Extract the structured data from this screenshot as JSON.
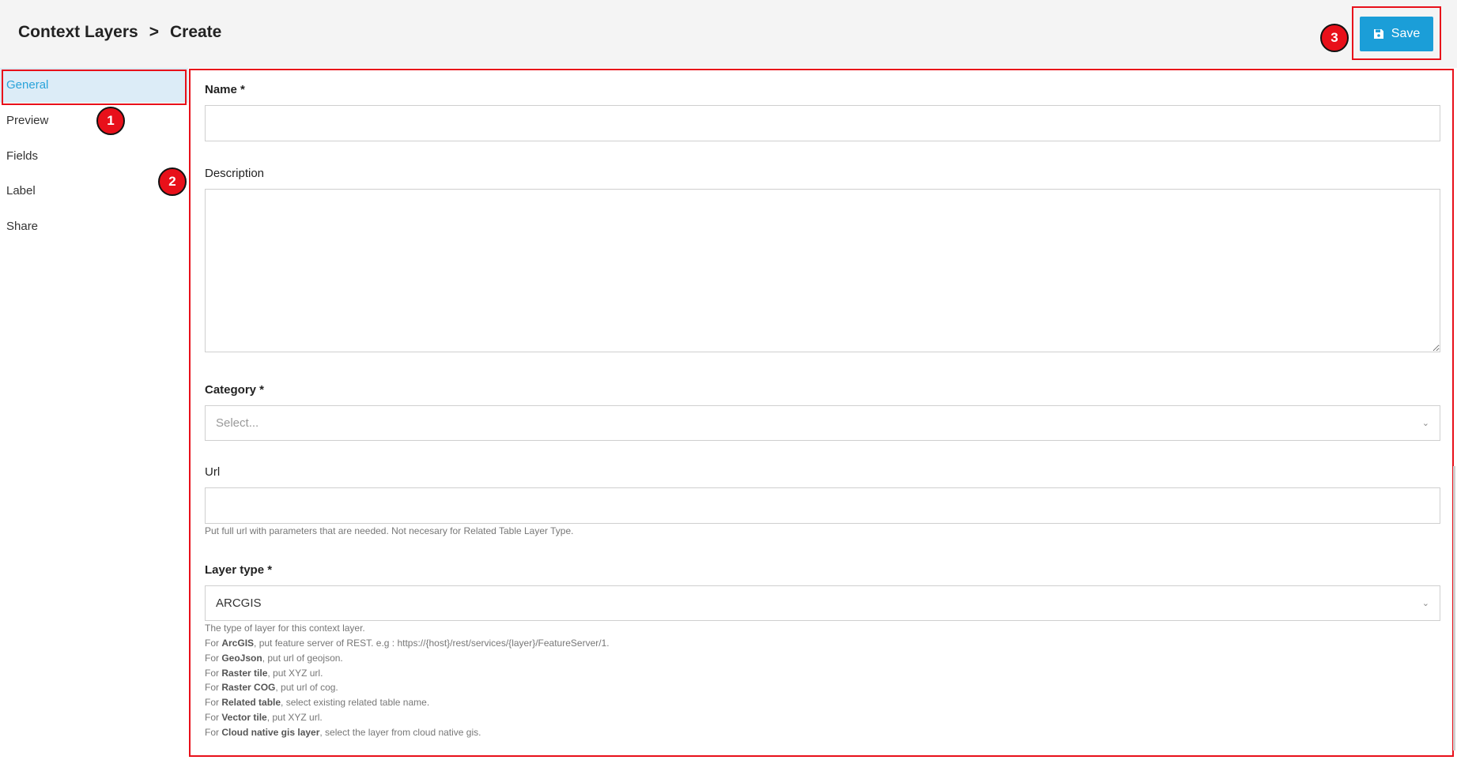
{
  "breadcrumb": {
    "parent": "Context Layers",
    "separator": ">",
    "current": "Create"
  },
  "toolbar": {
    "save_label": "Save",
    "save_icon": "floppy-disk-icon"
  },
  "sidebar": {
    "items": [
      {
        "label": "General",
        "active": true
      },
      {
        "label": "Preview"
      },
      {
        "label": "Fields"
      },
      {
        "label": "Label"
      },
      {
        "label": "Share"
      }
    ]
  },
  "annotations": {
    "marker1": "1",
    "marker2": "2",
    "marker3": "3"
  },
  "form": {
    "name_label": "Name *",
    "name_value": "",
    "description_label": "Description",
    "description_value": "",
    "category_label": "Category *",
    "category_placeholder": "Select...",
    "url_label": "Url",
    "url_value": "",
    "url_hint": "Put full url with parameters that are needed. Not necesary for Related Table Layer Type.",
    "layer_type_label": "Layer type *",
    "layer_type_value": "ARCGIS",
    "layer_type_help": [
      {
        "pre": "The type of layer for this context layer.",
        "bold": "",
        "post": ""
      },
      {
        "pre": "For ",
        "bold": "ArcGIS",
        "post": ", put feature server of REST. e.g : https://{host}/rest/services/{layer}/FeatureServer/1."
      },
      {
        "pre": "For ",
        "bold": "GeoJson",
        "post": ", put url of geojson."
      },
      {
        "pre": "For ",
        "bold": "Raster tile",
        "post": ", put XYZ url."
      },
      {
        "pre": "For ",
        "bold": "Raster COG",
        "post": ", put url of cog."
      },
      {
        "pre": "For ",
        "bold": "Related table",
        "post": ", select existing related table name."
      },
      {
        "pre": "For ",
        "bold": "Vector tile",
        "post": ", put XYZ url."
      },
      {
        "pre": "For ",
        "bold": "Cloud native gis layer",
        "post": ", select the layer from cloud native gis."
      }
    ]
  },
  "colors": {
    "accent": "#1b9ed8",
    "highlight": "#e8101a",
    "active_bg": "#dcecf7"
  }
}
